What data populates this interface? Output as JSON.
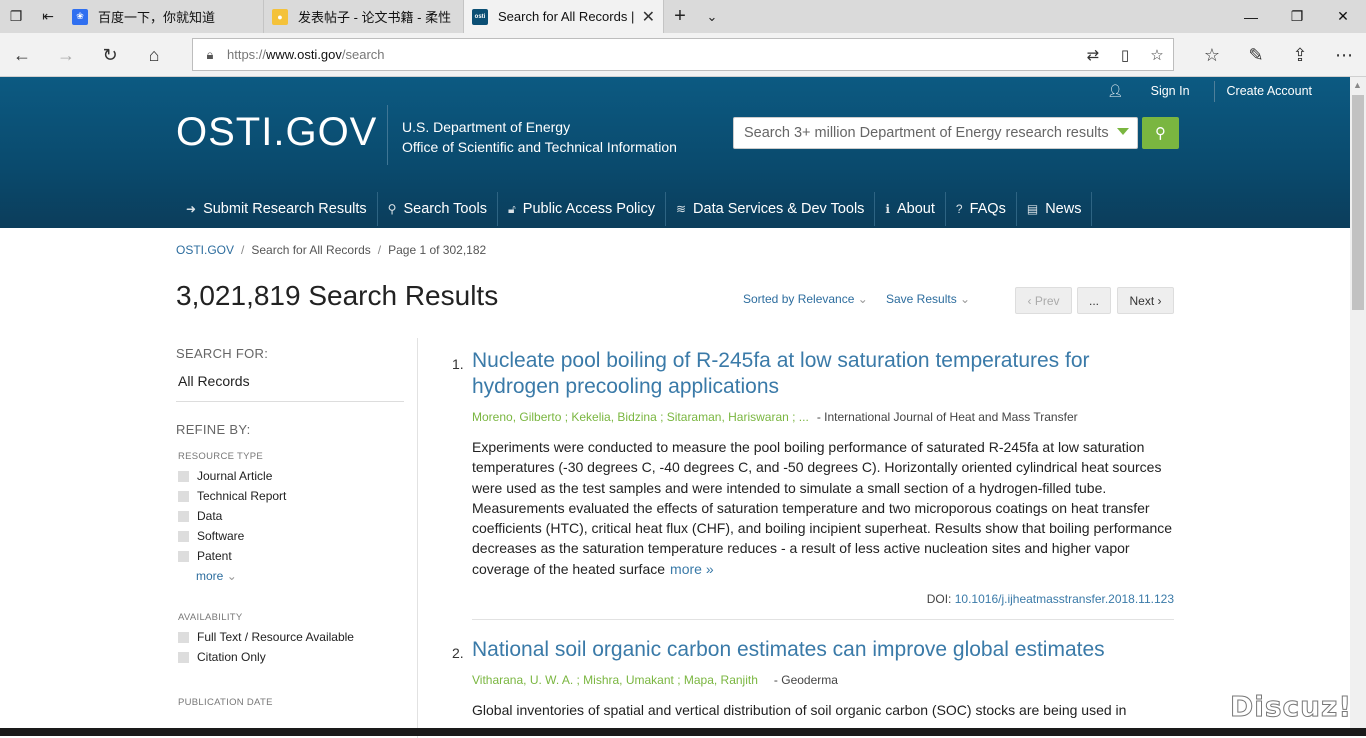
{
  "browser": {
    "tabs": [
      {
        "title": "百度一下，你就知道",
        "favicon": "baidu-icon",
        "active": false
      },
      {
        "title": "发表帖子 - 论文书籍 - 柔性",
        "favicon": "forum-icon",
        "active": false
      },
      {
        "title": "Search for All Records |",
        "favicon": "osti-icon",
        "favicon_text": "osti",
        "active": true
      }
    ],
    "url_prefix": "https://",
    "url_host": "www.osti.gov",
    "url_path": "/search"
  },
  "header": {
    "sign_in": "Sign In",
    "create_account": "Create Account",
    "logo": "OSTI.GOV",
    "dept_line1": "U.S. Department of Energy",
    "dept_line2": "Office of Scientific and Technical Information",
    "search_placeholder": "Search 3+ million Department of Energy research results",
    "nav": [
      {
        "label": "Submit Research Results",
        "icon": "sign-in-icon"
      },
      {
        "label": "Search Tools",
        "icon": "search-icon"
      },
      {
        "label": "Public Access Policy",
        "icon": "unlock-icon"
      },
      {
        "label": "Data Services & Dev Tools",
        "icon": "database-icon"
      },
      {
        "label": "About",
        "icon": "info-icon"
      },
      {
        "label": "FAQs",
        "icon": "question-icon"
      },
      {
        "label": "News",
        "icon": "newspaper-icon"
      }
    ]
  },
  "breadcrumb": {
    "home": "OSTI.GOV",
    "search": "Search for All Records",
    "page": "Page 1 of 302,182"
  },
  "results_count": "3,021,819 Search Results",
  "controls": {
    "sort": "Sorted by Relevance",
    "save": "Save Results",
    "prev": "‹ Prev",
    "dots": "...",
    "next": "Next ›"
  },
  "sidebar": {
    "search_for_label": "SEARCH FOR:",
    "search_for_value": "All Records",
    "refine_label": "REFINE BY:",
    "resource_type_label": "RESOURCE TYPE",
    "resource_types": [
      "Journal Article",
      "Technical Report",
      "Data",
      "Software",
      "Patent"
    ],
    "more": "more",
    "availability_label": "AVAILABILITY",
    "availability": [
      "Full Text / Resource Available",
      "Citation Only"
    ],
    "pubdate_label": "PUBLICATION DATE"
  },
  "results": [
    {
      "num": "1.",
      "title": "Nucleate pool boiling of R-245fa at low saturation temperatures for hydrogen precooling applications",
      "authors": "Moreno, Gilberto ; Kekelia, Bidzina ; Sitaraman, Hariswaran ; ...",
      "journal": "- International Journal of Heat and Mass Transfer",
      "abstract": "Experiments were conducted to measure the pool boiling performance of saturated R-245fa at low saturation temperatures (-30 degrees C, -40 degrees C, and -50 degrees C). Horizontally oriented cylindrical heat sources were used as the test samples and were intended to simulate a small section of a hydrogen-filled tube. Measurements evaluated the effects of saturation temperature and two microporous coatings on heat transfer coefficients (HTC), critical heat flux (CHF), and boiling incipient superheat. Results show that boiling performance decreases as the saturation temperature reduces - a result of less active nucleation sites and higher vapor coverage of the heated surface",
      "more": "more »",
      "doi_label": "DOI: ",
      "doi": "10.1016/j.ijheatmasstransfer.2018.11.123"
    },
    {
      "num": "2.",
      "title": "National soil organic carbon estimates can improve global estimates",
      "authors": "Vitharana, U. W. A. ; Mishra, Umakant ; Mapa, Ranjith",
      "journal": "- Geoderma",
      "abstract": "Global inventories of spatial and vertical distribution of soil organic carbon (SOC) stocks are being used in"
    }
  ],
  "watermark": "Discuz!"
}
